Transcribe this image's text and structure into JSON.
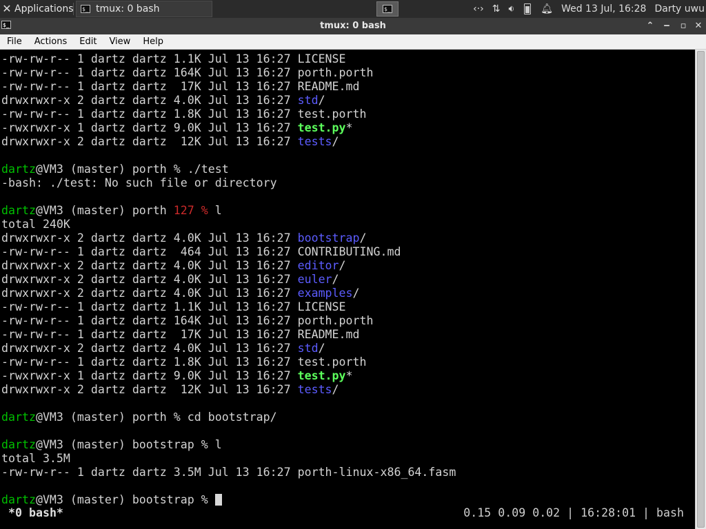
{
  "panel": {
    "applications_label": "Applications",
    "applications_icon": "xfce-logo-icon",
    "task_title": "tmux: 0 bash",
    "clock": "Wed 13 Jul, 16:28",
    "user": "Darty uwu",
    "tray_icons": [
      "network-icon",
      "transfer-icon",
      "volume-icon",
      "battery-icon",
      "notification-bell-icon"
    ]
  },
  "window": {
    "title": "tmux: 0 bash",
    "controls": [
      "minimize-icon",
      "restore-icon",
      "maximize-icon",
      "close-icon"
    ]
  },
  "menu": {
    "file": "File",
    "actions": "Actions",
    "edit": "Edit",
    "view": "View",
    "help": "Help"
  },
  "terminal": {
    "lines": [
      {
        "t": "ls",
        "perm": "-rw-rw-r-- 1 dartz dartz 1.1K Jul 13 16:27 ",
        "name": "LICENSE",
        "kind": "file",
        "suffix": ""
      },
      {
        "t": "ls",
        "perm": "-rw-rw-r-- 1 dartz dartz 164K Jul 13 16:27 ",
        "name": "porth.porth",
        "kind": "file",
        "suffix": ""
      },
      {
        "t": "ls",
        "perm": "-rw-rw-r-- 1 dartz dartz  17K Jul 13 16:27 ",
        "name": "README.md",
        "kind": "file",
        "suffix": ""
      },
      {
        "t": "ls",
        "perm": "drwxrwxr-x 2 dartz dartz 4.0K Jul 13 16:27 ",
        "name": "std",
        "kind": "dir",
        "suffix": "/"
      },
      {
        "t": "ls",
        "perm": "-rw-rw-r-- 1 dartz dartz 1.8K Jul 13 16:27 ",
        "name": "test.porth",
        "kind": "file",
        "suffix": ""
      },
      {
        "t": "ls",
        "perm": "-rwxrwxr-x 1 dartz dartz 9.0K Jul 13 16:27 ",
        "name": "test.py",
        "kind": "exe",
        "suffix": "*"
      },
      {
        "t": "ls",
        "perm": "drwxrwxr-x 2 dartz dartz  12K Jul 13 16:27 ",
        "name": "tests",
        "kind": "dir",
        "suffix": "/"
      },
      {
        "t": "blank"
      },
      {
        "t": "prompt",
        "user": "dartz",
        "rest": "@VM3 (master) porth ",
        "code": "",
        "sign": "%",
        "cmd": " ./test"
      },
      {
        "t": "text",
        "text": "-bash: ./test: No such file or directory"
      },
      {
        "t": "blank"
      },
      {
        "t": "prompt",
        "user": "dartz",
        "rest": "@VM3 (master) porth ",
        "code": "127 ",
        "sign": "%",
        "cmd": " l"
      },
      {
        "t": "text",
        "text": "total 240K"
      },
      {
        "t": "ls",
        "perm": "drwxrwxr-x 2 dartz dartz 4.0K Jul 13 16:27 ",
        "name": "bootstrap",
        "kind": "dir",
        "suffix": "/"
      },
      {
        "t": "ls",
        "perm": "-rw-rw-r-- 1 dartz dartz  464 Jul 13 16:27 ",
        "name": "CONTRIBUTING.md",
        "kind": "file",
        "suffix": ""
      },
      {
        "t": "ls",
        "perm": "drwxrwxr-x 2 dartz dartz 4.0K Jul 13 16:27 ",
        "name": "editor",
        "kind": "dir",
        "suffix": "/"
      },
      {
        "t": "ls",
        "perm": "drwxrwxr-x 2 dartz dartz 4.0K Jul 13 16:27 ",
        "name": "euler",
        "kind": "dir",
        "suffix": "/"
      },
      {
        "t": "ls",
        "perm": "drwxrwxr-x 2 dartz dartz 4.0K Jul 13 16:27 ",
        "name": "examples",
        "kind": "dir",
        "suffix": "/"
      },
      {
        "t": "ls",
        "perm": "-rw-rw-r-- 1 dartz dartz 1.1K Jul 13 16:27 ",
        "name": "LICENSE",
        "kind": "file",
        "suffix": ""
      },
      {
        "t": "ls",
        "perm": "-rw-rw-r-- 1 dartz dartz 164K Jul 13 16:27 ",
        "name": "porth.porth",
        "kind": "file",
        "suffix": ""
      },
      {
        "t": "ls",
        "perm": "-rw-rw-r-- 1 dartz dartz  17K Jul 13 16:27 ",
        "name": "README.md",
        "kind": "file",
        "suffix": ""
      },
      {
        "t": "ls",
        "perm": "drwxrwxr-x 2 dartz dartz 4.0K Jul 13 16:27 ",
        "name": "std",
        "kind": "dir",
        "suffix": "/"
      },
      {
        "t": "ls",
        "perm": "-rw-rw-r-- 1 dartz dartz 1.8K Jul 13 16:27 ",
        "name": "test.porth",
        "kind": "file",
        "suffix": ""
      },
      {
        "t": "ls",
        "perm": "-rwxrwxr-x 1 dartz dartz 9.0K Jul 13 16:27 ",
        "name": "test.py",
        "kind": "exe",
        "suffix": "*"
      },
      {
        "t": "ls",
        "perm": "drwxrwxr-x 2 dartz dartz  12K Jul 13 16:27 ",
        "name": "tests",
        "kind": "dir",
        "suffix": "/"
      },
      {
        "t": "blank"
      },
      {
        "t": "prompt",
        "user": "dartz",
        "rest": "@VM3 (master) porth ",
        "code": "",
        "sign": "%",
        "cmd": " cd bootstrap/"
      },
      {
        "t": "blank"
      },
      {
        "t": "prompt",
        "user": "dartz",
        "rest": "@VM3 (master) bootstrap ",
        "code": "",
        "sign": "%",
        "cmd": " l"
      },
      {
        "t": "text",
        "text": "total 3.5M"
      },
      {
        "t": "ls",
        "perm": "-rw-rw-r-- 1 dartz dartz 3.5M Jul 13 16:27 ",
        "name": "porth-linux-x86_64.fasm",
        "kind": "file",
        "suffix": ""
      },
      {
        "t": "blank"
      },
      {
        "t": "prompt",
        "user": "dartz",
        "rest": "@VM3 (master) bootstrap ",
        "code": "",
        "sign": "%",
        "cmd": " ",
        "cursor": true
      }
    ]
  },
  "tmux_status": {
    "window": "*0 bash*",
    "right": "0.15 0.09 0.02 | 16:28:01 | bash"
  },
  "colors": {
    "directory": "#5c5cff",
    "executable": "#5cff5c",
    "prompt_user": "#00c000",
    "exit_code": "#cc2a2a"
  }
}
